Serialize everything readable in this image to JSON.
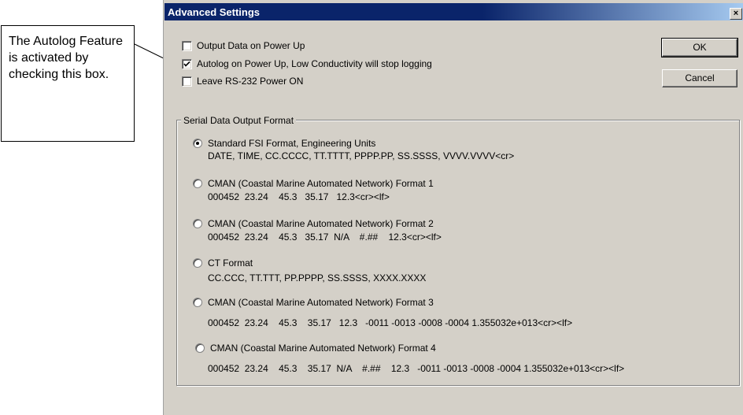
{
  "callout": {
    "text": "The Autolog Feature is activated by checking this box."
  },
  "dialog": {
    "title": "Advanced Settings",
    "close_glyph": "×",
    "ok_label": "OK",
    "cancel_label": "Cancel",
    "checkboxes": [
      {
        "label": "Output Data on Power Up",
        "checked": false
      },
      {
        "label": "Autolog on Power Up, Low Conductivity will stop logging",
        "checked": true
      },
      {
        "label": "Leave RS-232 Power ON",
        "checked": false
      }
    ],
    "group_label": "Serial Data Output Format",
    "formats": [
      {
        "label": "Standard FSI Format, Engineering Units",
        "sample": "DATE, TIME, CC.CCCC, TT.TTTT, PPPP.PP, SS.SSSS, VVVV.VVVV<cr>",
        "selected": true
      },
      {
        "label": "CMAN (Coastal Marine Automated Network) Format 1",
        "sample": "000452  23.24    45.3   35.17   12.3<cr><lf>",
        "selected": false
      },
      {
        "label": "CMAN (Coastal Marine Automated Network) Format 2",
        "sample": "000452  23.24    45.3   35.17  N/A    #.##    12.3<cr><lf>",
        "selected": false
      },
      {
        "label": "CT Format",
        "sample": "CC.CCC, TT.TTT, PP.PPPP, SS.SSSS, XXXX.XXXX",
        "selected": false
      },
      {
        "label": "CMAN (Coastal Marine Automated Network) Format 3",
        "sample": "000452  23.24    45.3    35.17   12.3   -0011 -0013 -0008 -0004 1.355032e+013<cr><lf>",
        "selected": false
      },
      {
        "label": "CMAN (Coastal Marine Automated Network) Format 4",
        "sample": "000452  23.24    45.3    35.17  N/A    #.##    12.3   -0011 -0013 -0008 -0004 1.355032e+013<cr><lf>",
        "selected": false
      }
    ]
  }
}
